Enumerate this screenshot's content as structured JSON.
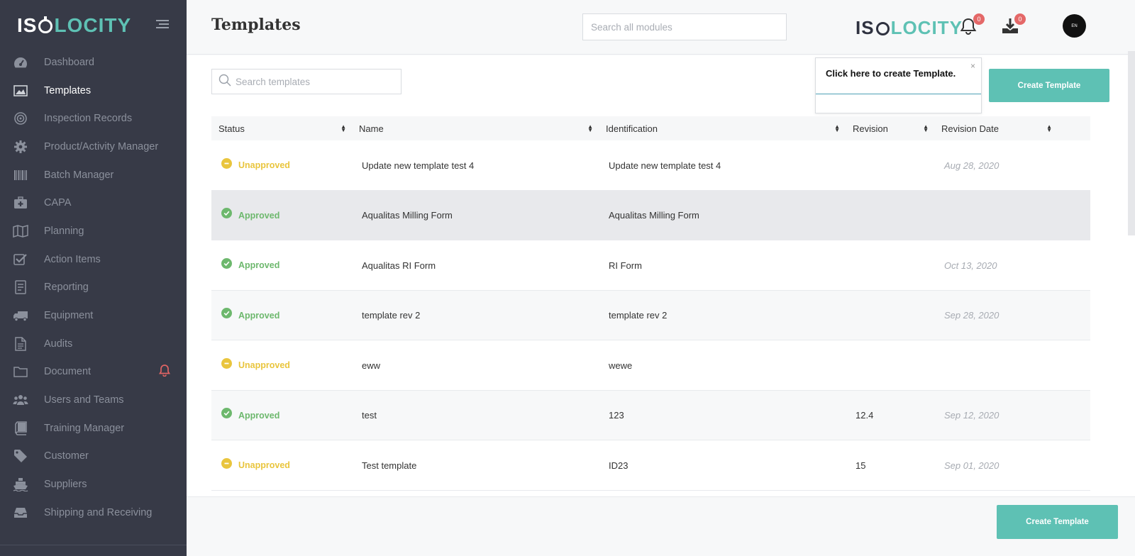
{
  "brand": {
    "logo_part1": "ISO",
    "logo_part2": "LOCITY"
  },
  "header": {
    "title": "Templates",
    "search_placeholder": "Search all modules",
    "notifications_count": "0",
    "downloads_count": "0",
    "avatar_label": "EN"
  },
  "sidebar": {
    "items": [
      {
        "label": "Dashboard",
        "icon": "dashboard-icon",
        "active": false
      },
      {
        "label": "Templates",
        "icon": "image-icon",
        "active": true
      },
      {
        "label": "Inspection Records",
        "icon": "target-icon",
        "active": false
      },
      {
        "label": "Product/Activity Manager",
        "icon": "gear-icon",
        "active": false
      },
      {
        "label": "Batch Manager",
        "icon": "barcode-icon",
        "active": false
      },
      {
        "label": "CAPA",
        "icon": "first-aid-icon",
        "active": false
      },
      {
        "label": "Planning",
        "icon": "map-icon",
        "active": false
      },
      {
        "label": "Action Items",
        "icon": "checkbox-icon",
        "active": false
      },
      {
        "label": "Reporting",
        "icon": "report-icon",
        "active": false
      },
      {
        "label": "Equipment",
        "icon": "truck-icon",
        "active": false
      },
      {
        "label": "Audits",
        "icon": "file-icon",
        "active": false
      },
      {
        "label": "Document",
        "icon": "folder-icon",
        "active": false
      },
      {
        "label": "Users and Teams",
        "icon": "users-icon",
        "active": false
      },
      {
        "label": "Training Manager",
        "icon": "book-icon",
        "active": false
      },
      {
        "label": "Customer",
        "icon": "tag-icon",
        "active": false
      },
      {
        "label": "Suppliers",
        "icon": "ship-icon",
        "active": false
      },
      {
        "label": "Shipping and Receiving",
        "icon": "inbox-icon",
        "active": false
      }
    ]
  },
  "main": {
    "search_placeholder": "Search templates",
    "create_button_label": "Create Template",
    "tooltip_text": "Click here to create Template.",
    "tooltip_close": "×",
    "columns": [
      "Status",
      "Name",
      "Identification",
      "Revision",
      "Revision Date"
    ],
    "rows": [
      {
        "status": "Unapproved",
        "name": "Update new template test 4",
        "identification": "Update new template test 4",
        "revision": "",
        "date": "Aug 28, 2020"
      },
      {
        "status": "Approved",
        "name": "Aqualitas Milling Form",
        "identification": "Aqualitas Milling Form",
        "revision": "",
        "date": ""
      },
      {
        "status": "Approved",
        "name": "Aqualitas RI Form",
        "identification": "RI Form",
        "revision": "",
        "date": "Oct 13, 2020"
      },
      {
        "status": "Approved",
        "name": "template rev 2",
        "identification": "template rev 2",
        "revision": "",
        "date": "Sep 28, 2020"
      },
      {
        "status": "Unapproved",
        "name": "eww",
        "identification": "wewe",
        "revision": "",
        "date": ""
      },
      {
        "status": "Approved",
        "name": "test",
        "identification": "123",
        "revision": "12.4",
        "date": "Sep 12, 2020"
      },
      {
        "status": "Unapproved",
        "name": "Test template",
        "identification": "ID23",
        "revision": "15",
        "date": "Sep 01, 2020"
      }
    ]
  },
  "colors": {
    "sidebar_bg": "#373a47",
    "accent": "#5ec1b4",
    "approved": "#6db86d",
    "unapproved": "#e9c53d",
    "badge": "#e46868"
  }
}
